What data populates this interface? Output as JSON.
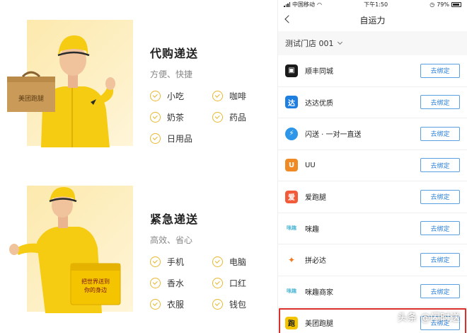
{
  "promo": {
    "sections": [
      {
        "title": "代购递送",
        "subtitle": "方便、快捷",
        "items": [
          "小吃",
          "咖啡",
          "奶茶",
          "药品",
          "日用品"
        ]
      },
      {
        "title": "紧急递送",
        "subtitle": "高效、省心",
        "items": [
          "手机",
          "电脑",
          "香水",
          "口红",
          "衣服",
          "钱包"
        ]
      }
    ],
    "box_brand": "美团跑腿",
    "bag_slogan_line1": "把世界送到",
    "bag_slogan_line2": "你的身边",
    "accent": "#f5c400",
    "check_color": "#e8b830"
  },
  "phone": {
    "status": {
      "carrier": "中国移动",
      "time": "下午1:50",
      "battery": "79%"
    },
    "nav": {
      "title": "自运力"
    },
    "store": {
      "label": "测试门店 001"
    },
    "bind_label": "去绑定",
    "providers": [
      {
        "name": "顺丰同城",
        "icon": "sf-icon",
        "color": "#1a1a1a"
      },
      {
        "name": "达达优质",
        "icon": "dada-icon",
        "color": "#1f7fe0"
      },
      {
        "name": "闪送 · 一对一直送",
        "icon": "shansong-icon",
        "color": "#2d96e8"
      },
      {
        "name": "UU",
        "icon": "uu-icon",
        "color": "#f08a24"
      },
      {
        "name": "爱跑腿",
        "icon": "aipaotui-icon",
        "color": "#f25b3a"
      },
      {
        "name": "咪趣",
        "icon": "miqu-icon",
        "color": "#4fb8d6"
      },
      {
        "name": "拼必达",
        "icon": "pinbida-icon",
        "color": "#f07a20"
      },
      {
        "name": "咪趣商家",
        "icon": "miqu-merchant-icon",
        "color": "#4fb8d6"
      },
      {
        "name": "美团跑腿",
        "icon": "meituan-paotui-icon",
        "color": "#f5c400"
      }
    ],
    "watermark": "头条 @闪时送"
  }
}
